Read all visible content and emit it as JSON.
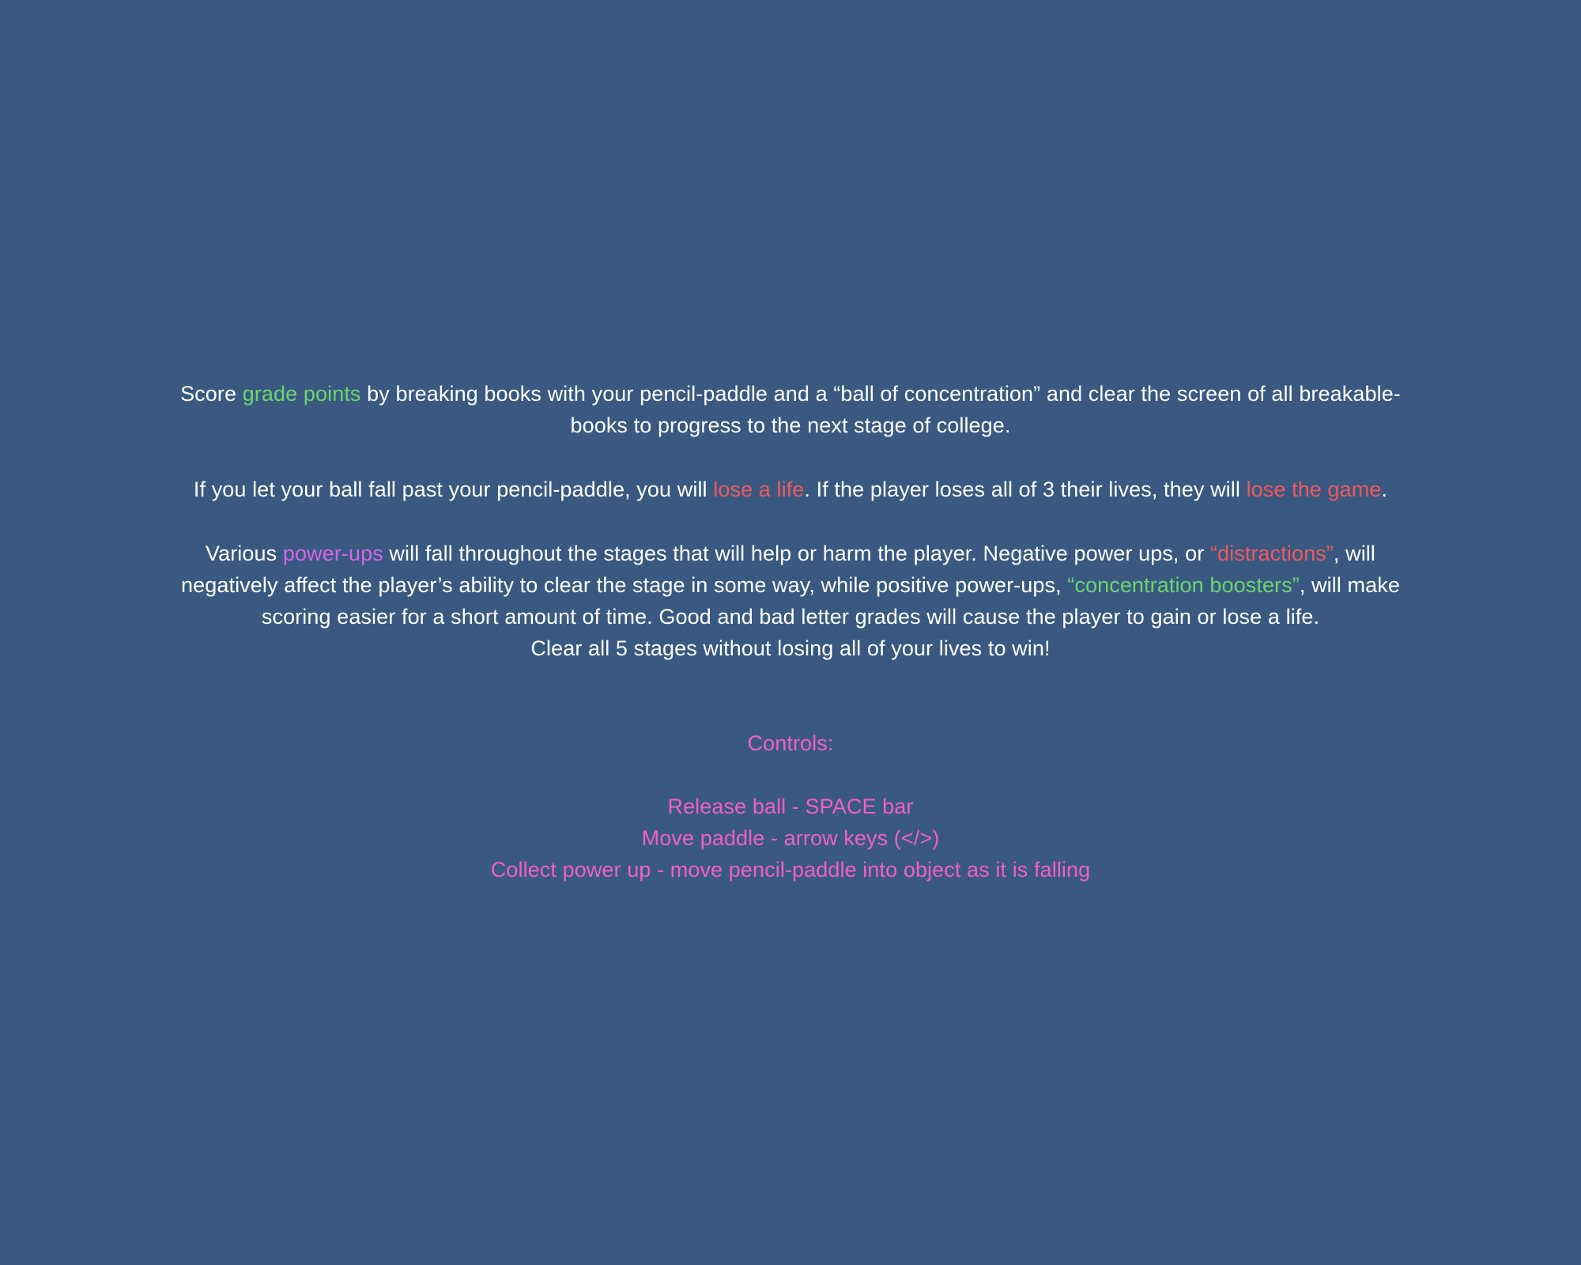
{
  "background_color": "#395981",
  "colors": {
    "text": "#ffffff",
    "grade_green": "#6fd36e",
    "danger_red": "#f0585d",
    "powerup_purple": "#d567e8",
    "controls_pink": "#f25fc6"
  },
  "intro": {
    "l1_a": "Score ",
    "l1_grade_points": "grade points",
    "l1_b": " by breaking books with your pencil-paddle and a “ball of concentration” and clear the screen of all breakable-",
    "l2": "books to progress to the next stage of college."
  },
  "lives": {
    "a": "If you let your ball fall past your pencil-paddle, you will ",
    "lose_a_life": "lose a life",
    "b": ". If the player loses all of 3 their lives, they will ",
    "lose_the_game": "lose the game",
    "c": "."
  },
  "powerups": {
    "l1_a": "Various ",
    "power_ups": "power-ups",
    "l1_b": " will fall throughout the stages that will help or harm the player. Negative power ups, or  ",
    "distractions": "“distractions”",
    "l1_c": ", will",
    "l2_a": "negatively affect the player’s ability to clear the stage in some way, while positive power-ups, ",
    "concentration_boosters": "“concentration boosters”",
    "l2_b": ", will make",
    "l3": "scoring easier for a short amount of time. Good and bad letter grades will cause the player to gain or lose a life.",
    "l4": "Clear all 5 stages without losing all of your lives to win!"
  },
  "controls": {
    "heading": "Controls:",
    "items": [
      "Release ball - SPACE bar",
      "Move paddle - arrow keys (</>)",
      "Collect power up - move pencil-paddle into object as it is falling"
    ]
  }
}
